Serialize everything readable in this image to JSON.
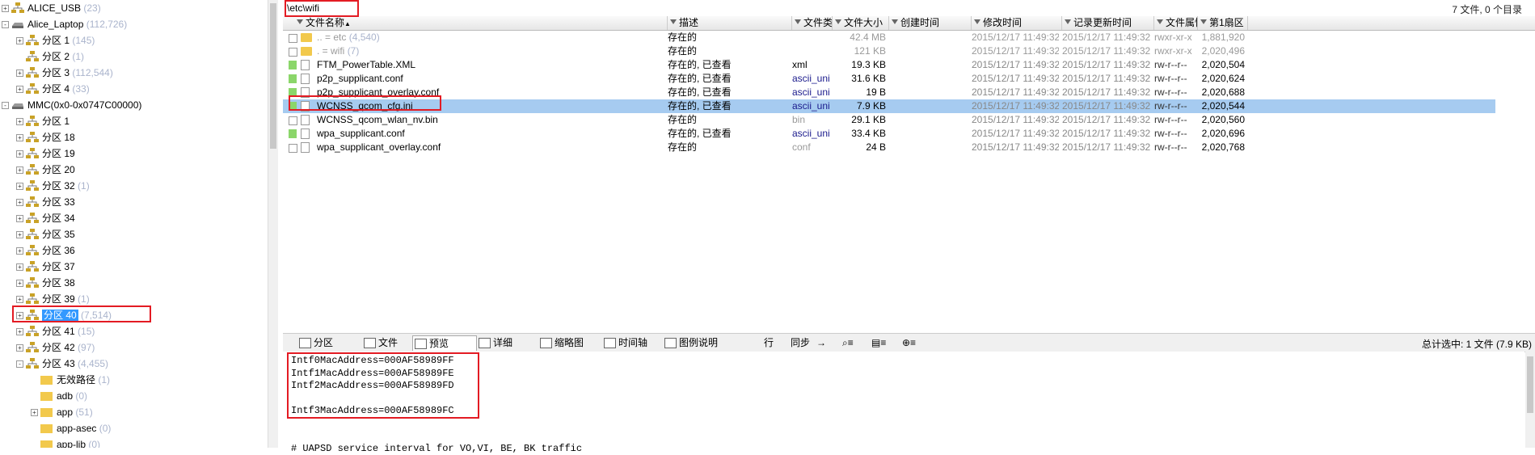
{
  "tree": [
    {
      "label": "ALICE_USB",
      "count": "(23)",
      "exp": "+"
    },
    {
      "label": "Alice_Laptop",
      "count": "(112,726)",
      "exp": "−"
    },
    {
      "label": "分区 1",
      "count": "(145)",
      "exp": "+"
    },
    {
      "label": "分区 2",
      "count": "(1)",
      "exp": ""
    },
    {
      "label": "分区 3",
      "count": "(112,544)",
      "exp": "+"
    },
    {
      "label": "分区 4",
      "count": "(33)",
      "exp": "+"
    },
    {
      "label": "MMC(0x0-0x0747C00000)",
      "count": "",
      "exp": "−"
    },
    {
      "label": "分区 1",
      "count": "",
      "exp": "+"
    },
    {
      "label": "分区 18",
      "count": "",
      "exp": "+"
    },
    {
      "label": "分区 19",
      "count": "",
      "exp": "+"
    },
    {
      "label": "分区 20",
      "count": "",
      "exp": "+"
    },
    {
      "label": "分区 32",
      "count": "(1)",
      "exp": "+"
    },
    {
      "label": "分区 33",
      "count": "",
      "exp": "+"
    },
    {
      "label": "分区 34",
      "count": "",
      "exp": "+"
    },
    {
      "label": "分区 35",
      "count": "",
      "exp": "+"
    },
    {
      "label": "分区 36",
      "count": "",
      "exp": "+"
    },
    {
      "label": "分区 37",
      "count": "",
      "exp": "+"
    },
    {
      "label": "分区 38",
      "count": "",
      "exp": "+"
    },
    {
      "label": "分区 39",
      "count": "(1)",
      "exp": "+"
    },
    {
      "label": "分区 40",
      "count": "(7,514)",
      "exp": "+"
    },
    {
      "label": "分区 41",
      "count": "(15)",
      "exp": "+"
    },
    {
      "label": "分区 42",
      "count": "(97)",
      "exp": "+"
    },
    {
      "label": "分区 43",
      "count": "(4,455)",
      "exp": "−"
    },
    {
      "label": "无效路径",
      "count": "(1)",
      "exp": ""
    },
    {
      "label": "adb",
      "count": "(0)",
      "exp": ""
    },
    {
      "label": "app",
      "count": "(51)",
      "exp": "+"
    },
    {
      "label": "app-asec",
      "count": "(0)",
      "exp": ""
    },
    {
      "label": "app-lib",
      "count": "(0)",
      "exp": ""
    }
  ],
  "path": "\\etc\\wifi",
  "summary": "7 文件, 0 个目录",
  "columns": [
    "文件名称",
    "描述",
    "文件类型",
    "文件大小",
    "创建时间",
    "修改时间",
    "记录更新时间",
    "文件属性",
    "第1扇区"
  ],
  "files": [
    {
      "name": "..  =   etc",
      "count": "(4,540)",
      "desc": "存在的",
      "type": "",
      "size": "42.4 MB",
      "created": "",
      "modified": "2015/12/17  11:49:32",
      "updated": "2015/12/17  11:49:32",
      "attr": "rwxr-xr-x",
      "sector": "1,881,920",
      "kind": "folder",
      "muted": true
    },
    {
      "name": ".   =   wifi",
      "count": "(7)",
      "desc": "存在的",
      "type": "",
      "size": "121 KB",
      "created": "",
      "modified": "2015/12/17  11:49:32",
      "updated": "2015/12/17  11:49:32",
      "attr": "rwxr-xr-x",
      "sector": "2,020,496",
      "kind": "folder",
      "muted": true
    },
    {
      "name": "FTM_PowerTable.XML",
      "count": "",
      "desc": "存在的, 已查看",
      "type": "xml",
      "size": "19.3 KB",
      "created": "",
      "modified": "2015/12/17  11:49:32",
      "updated": "2015/12/17  11:49:32",
      "attr": "rw-r--r--",
      "sector": "2,020,504",
      "kind": "file",
      "tag": true
    },
    {
      "name": "p2p_supplicant.conf",
      "count": "",
      "desc": "存在的, 已查看",
      "type": "ascii_unix",
      "size": "31.6 KB",
      "created": "",
      "modified": "2015/12/17  11:49:32",
      "updated": "2015/12/17  11:49:32",
      "attr": "rw-r--r--",
      "sector": "2,020,624",
      "kind": "file",
      "tag": true
    },
    {
      "name": "p2p_supplicant_overlay.conf",
      "count": "",
      "desc": "存在的, 已查看",
      "type": "ascii_unix",
      "size": "19 B",
      "created": "",
      "modified": "2015/12/17  11:49:32",
      "updated": "2015/12/17  11:49:32",
      "attr": "rw-r--r--",
      "sector": "2,020,688",
      "kind": "file",
      "tag": true
    },
    {
      "name": "WCNSS_qcom_cfg.ini",
      "count": "",
      "desc": "存在的, 已查看",
      "type": "ascii_unix",
      "size": "7.9 KB",
      "created": "",
      "modified": "2015/12/17  11:49:32",
      "updated": "2015/12/17  11:49:32",
      "attr": "rw-r--r--",
      "sector": "2,020,544",
      "kind": "file",
      "tag": true,
      "selected": true
    },
    {
      "name": "WCNSS_qcom_wlan_nv.bin",
      "count": "",
      "desc": "存在的",
      "type": "bin",
      "size": "29.1 KB",
      "created": "",
      "modified": "2015/12/17  11:49:32",
      "updated": "2015/12/17  11:49:32",
      "attr": "rw-r--r--",
      "sector": "2,020,560",
      "kind": "file"
    },
    {
      "name": "wpa_supplicant.conf",
      "count": "",
      "desc": "存在的, 已查看",
      "type": "ascii_unix",
      "size": "33.4 KB",
      "created": "",
      "modified": "2015/12/17  11:49:32",
      "updated": "2015/12/17  11:49:32",
      "attr": "rw-r--r--",
      "sector": "2,020,696",
      "kind": "file",
      "tag": true
    },
    {
      "name": "wpa_supplicant_overlay.conf",
      "count": "",
      "desc": "存在的",
      "type": "conf",
      "size": "24 B",
      "created": "",
      "modified": "2015/12/17  11:49:32",
      "updated": "2015/12/17  11:49:32",
      "attr": "rw-r--r--",
      "sector": "2,020,768",
      "kind": "file"
    }
  ],
  "toolbar": {
    "partition": "分区",
    "file": "文件",
    "preview": "预览",
    "detail": "详细",
    "thumbnail": "缩略图",
    "timeline": "时间轴",
    "legend": "图例说明",
    "row": "行",
    "sync": "同步",
    "status": "总计选中: 1 文件 (7.9 KB)"
  },
  "preview_lines": [
    "Intf0MacAddress=000AF58989FF",
    "Intf1MacAddress=000AF58989FE",
    "Intf2MacAddress=000AF58989FD",
    "",
    "Intf3MacAddress=000AF58989FC",
    "",
    "",
    "# UAPSD service interval for VO,VI, BE, BK traffic"
  ],
  "colors": {
    "highlight": "#e31b23",
    "selected_row": "#a6cbf0",
    "tag": "#8bd66a"
  }
}
